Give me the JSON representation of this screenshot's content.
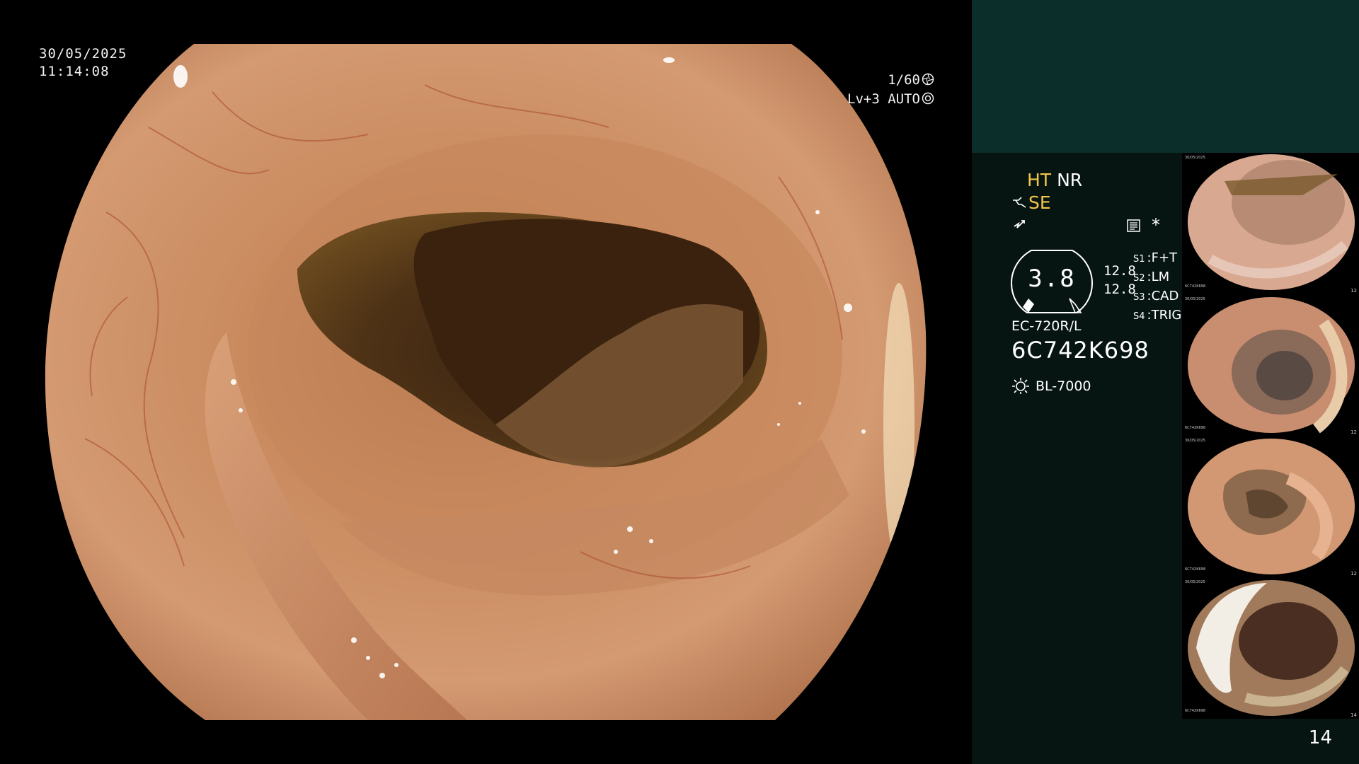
{
  "overlay": {
    "date": "30/05/2025",
    "time": "11:14:08",
    "shutter": "1/60",
    "brightness_level": "Lv+3",
    "iris_mode": "AUTO"
  },
  "status": {
    "ht": "HT",
    "nr": "NR",
    "se": "SE",
    "star": "*",
    "gauge_value": "3.8",
    "gauge_side_top": "12.8",
    "gauge_side_bottom": "12.8",
    "switches": [
      {
        "label": "S1",
        "value": "F+T"
      },
      {
        "label": "S2",
        "value": "LM"
      },
      {
        "label": "S3",
        "value": "CAD"
      },
      {
        "label": "S4",
        "value": "TRIG"
      }
    ],
    "scope_model": "EC-720R/L",
    "scope_serial": "6C742K698",
    "light_source": "BL-7000"
  },
  "thumbnails": [
    {
      "date": "30/05/2025",
      "serial": "6C742K698",
      "number": "12"
    },
    {
      "date": "30/05/2025",
      "serial": "6C742K698",
      "number": "12"
    },
    {
      "date": "30/05/2025",
      "serial": "6C742K698",
      "number": "12"
    },
    {
      "date": "30/05/2025",
      "serial": "6C742K698",
      "number": "14"
    }
  ],
  "frame_number": "14",
  "colors": {
    "accent_yellow": "#f3c54a",
    "panel_dark": "#061512",
    "panel_teal": "#0b2e2a",
    "mucosa": "#c8845a"
  },
  "icons": [
    "shutter-icon",
    "iris-icon",
    "structure-enhance-icon",
    "bolt-icon",
    "record-book-icon",
    "light-source-icon"
  ]
}
